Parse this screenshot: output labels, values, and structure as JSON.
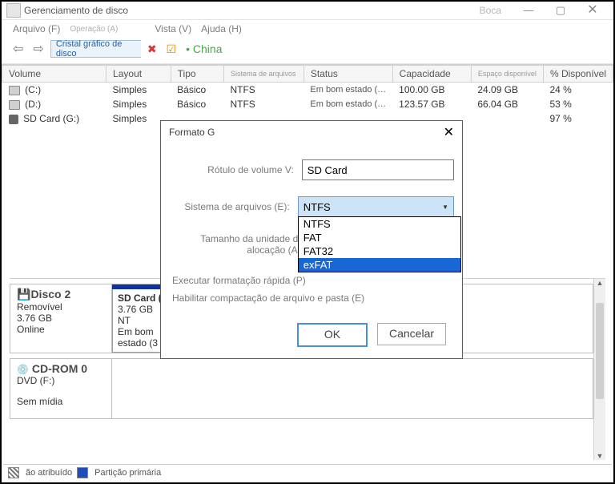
{
  "window": {
    "title": "Gerenciamento de disco",
    "extra_caption": "Boca"
  },
  "menu": {
    "file": "Arquivo (F)",
    "operation": "Operação (A)",
    "view": "Vista (V)",
    "help": "Ajuda (H)"
  },
  "toolbar": {
    "crumb": "Cristal gráfico de disco",
    "china": "China"
  },
  "table": {
    "headers": {
      "volume": "Volume",
      "layout": "Layout",
      "type": "Tipo",
      "fs": "Sistema de arquivos",
      "status": "Status",
      "capacity": "Capacidade",
      "free": "Espaço disponível",
      "pct": "% Disponível"
    },
    "rows": [
      {
        "icon": "drive",
        "volume": "(C:)",
        "layout": "Simples",
        "type": "Básico",
        "fs": "NTFS",
        "status": "Em bom estado (…",
        "capacity": "100.00 GB",
        "free": "24.09 GB",
        "pct": "24 %"
      },
      {
        "icon": "drive",
        "volume": "(D:)",
        "layout": "Simples",
        "type": "Básico",
        "fs": "NTFS",
        "status": "Em bom estado (…",
        "capacity": "123.57 GB",
        "free": "66.04 GB",
        "pct": "53 %"
      },
      {
        "icon": "sd",
        "volume": "SD Card (G:)",
        "layout": "Simples",
        "type": "",
        "fs": "",
        "status": "",
        "capacity": "",
        "free": "",
        "pct": "97 %"
      }
    ]
  },
  "dialog": {
    "title": "Formato G",
    "labels": {
      "volume_label": "Rótulo de volume V:",
      "fs": "Sistema de arquivos (E):",
      "alloc": "Tamanho da unidade de alocação (A):",
      "quick": "Executar formatação rápida (P)",
      "compress": "Habilitar compactação de arquivo e pasta (E)"
    },
    "volume_value": "SD Card",
    "fs_selected": "NTFS",
    "fs_options": [
      "NTFS",
      "FAT",
      "FAT32",
      "exFAT"
    ],
    "fs_highlight_index": 3,
    "buttons": {
      "ok": "OK",
      "cancel": "Cancelar"
    }
  },
  "disk2": {
    "name": "Disco 2",
    "type": "Removível",
    "size": "3.76 GB",
    "state": "Online",
    "part_name": "SD Card  (",
    "part_line": "3.76 GB NT",
    "part_status": "Em bom estado (3"
  },
  "cdrom": {
    "name": "CD-ROM 0",
    "line": "DVD (F:)",
    "status": "Sem mídia"
  },
  "statusbar": {
    "unalloc": "ão atribuído",
    "primary": "Partição primária"
  }
}
